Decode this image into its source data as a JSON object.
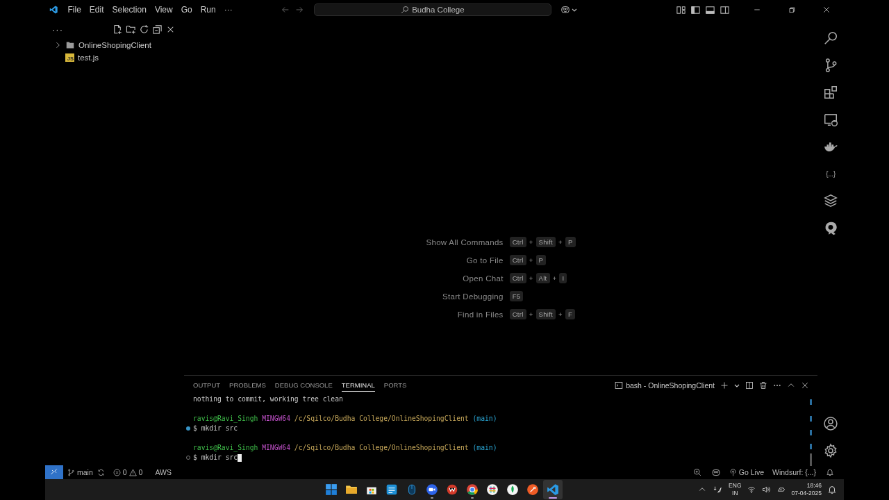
{
  "window": {
    "title": "Budha College"
  },
  "menu": [
    "File",
    "Edit",
    "Selection",
    "View",
    "Go",
    "Run",
    "···"
  ],
  "explorer": {
    "more": "···",
    "tree": [
      {
        "label": "OnlineShopingClient",
        "kind": "folder",
        "expanded": false
      },
      {
        "label": "test.js",
        "kind": "js",
        "badge": "JS"
      }
    ]
  },
  "activity_bar": [
    {
      "kind": "search"
    },
    {
      "kind": "source-control"
    },
    {
      "kind": "extensions"
    },
    {
      "kind": "remote"
    },
    {
      "kind": "docker"
    },
    {
      "kind": "json",
      "glyph": "{...}"
    },
    {
      "kind": "stack"
    },
    {
      "kind": "q-logo"
    }
  ],
  "shortcuts": [
    {
      "label": "Show All Commands",
      "keys": [
        "Ctrl",
        "+",
        "Shift",
        "+",
        "P"
      ]
    },
    {
      "label": "Go to File",
      "keys": [
        "Ctrl",
        "+",
        "P"
      ]
    },
    {
      "label": "Open Chat",
      "keys": [
        "Ctrl",
        "+",
        "Alt",
        "+",
        "I"
      ]
    },
    {
      "label": "Start Debugging",
      "keys": [
        "F5"
      ]
    },
    {
      "label": "Find in Files",
      "keys": [
        "Ctrl",
        "+",
        "Shift",
        "+",
        "F"
      ]
    }
  ],
  "panel": {
    "tabs": [
      {
        "label": "OUTPUT",
        "selected": false
      },
      {
        "label": "PROBLEMS",
        "selected": false
      },
      {
        "label": "DEBUG CONSOLE",
        "selected": false
      },
      {
        "label": "TERMINAL",
        "selected": true
      },
      {
        "label": "PORTS",
        "selected": false
      }
    ],
    "terminal_name": "bash - OnlineShopingClient",
    "lines": [
      {
        "kind": "output",
        "text": "nothing to commit, working tree clean"
      },
      {
        "kind": "blank"
      },
      {
        "kind": "prompt",
        "user": "ravis@Ravi_Singh",
        "system": "MINGW64",
        "path": "/c/Sqilco/Budha College/OnlineShopingClient",
        "branch": "(main)"
      },
      {
        "kind": "command",
        "sign": "$",
        "text": "mkdir src",
        "succeeded": true,
        "cursor": false
      },
      {
        "kind": "blank"
      },
      {
        "kind": "prompt",
        "user": "ravis@Ravi_Singh",
        "system": "MINGW64",
        "path": "/c/Sqilco/Budha College/OnlineShopingClient",
        "branch": "(main)"
      },
      {
        "kind": "command",
        "sign": "$",
        "text": "mkdir src",
        "succeeded": false,
        "cursor": true
      }
    ]
  },
  "status_bar": {
    "branch": "main",
    "errors": "0",
    "warnings": "0",
    "left_items": [
      "AWS"
    ],
    "go_live": "Go Live",
    "windsurf": "Windsurf: {...}"
  },
  "taskbar": {
    "apps": [
      {
        "kind": "start",
        "open": false,
        "active": false
      },
      {
        "kind": "folder",
        "open": false,
        "active": false
      },
      {
        "kind": "store",
        "open": false,
        "active": false
      },
      {
        "kind": "document",
        "open": false,
        "active": false
      },
      {
        "kind": "mouse",
        "open": false,
        "active": false
      },
      {
        "kind": "video",
        "open": true,
        "active": false
      },
      {
        "kind": "office",
        "open": false,
        "active": false
      },
      {
        "kind": "browser",
        "open": true,
        "active": false
      },
      {
        "kind": "hash",
        "open": false,
        "active": false
      },
      {
        "kind": "leaf",
        "open": false,
        "active": false
      },
      {
        "kind": "rocket",
        "open": false,
        "active": false
      },
      {
        "kind": "code",
        "open": true,
        "active": true
      }
    ],
    "language": "ENG",
    "region": "IN",
    "time": "18:46",
    "date": "07-04-2025"
  }
}
